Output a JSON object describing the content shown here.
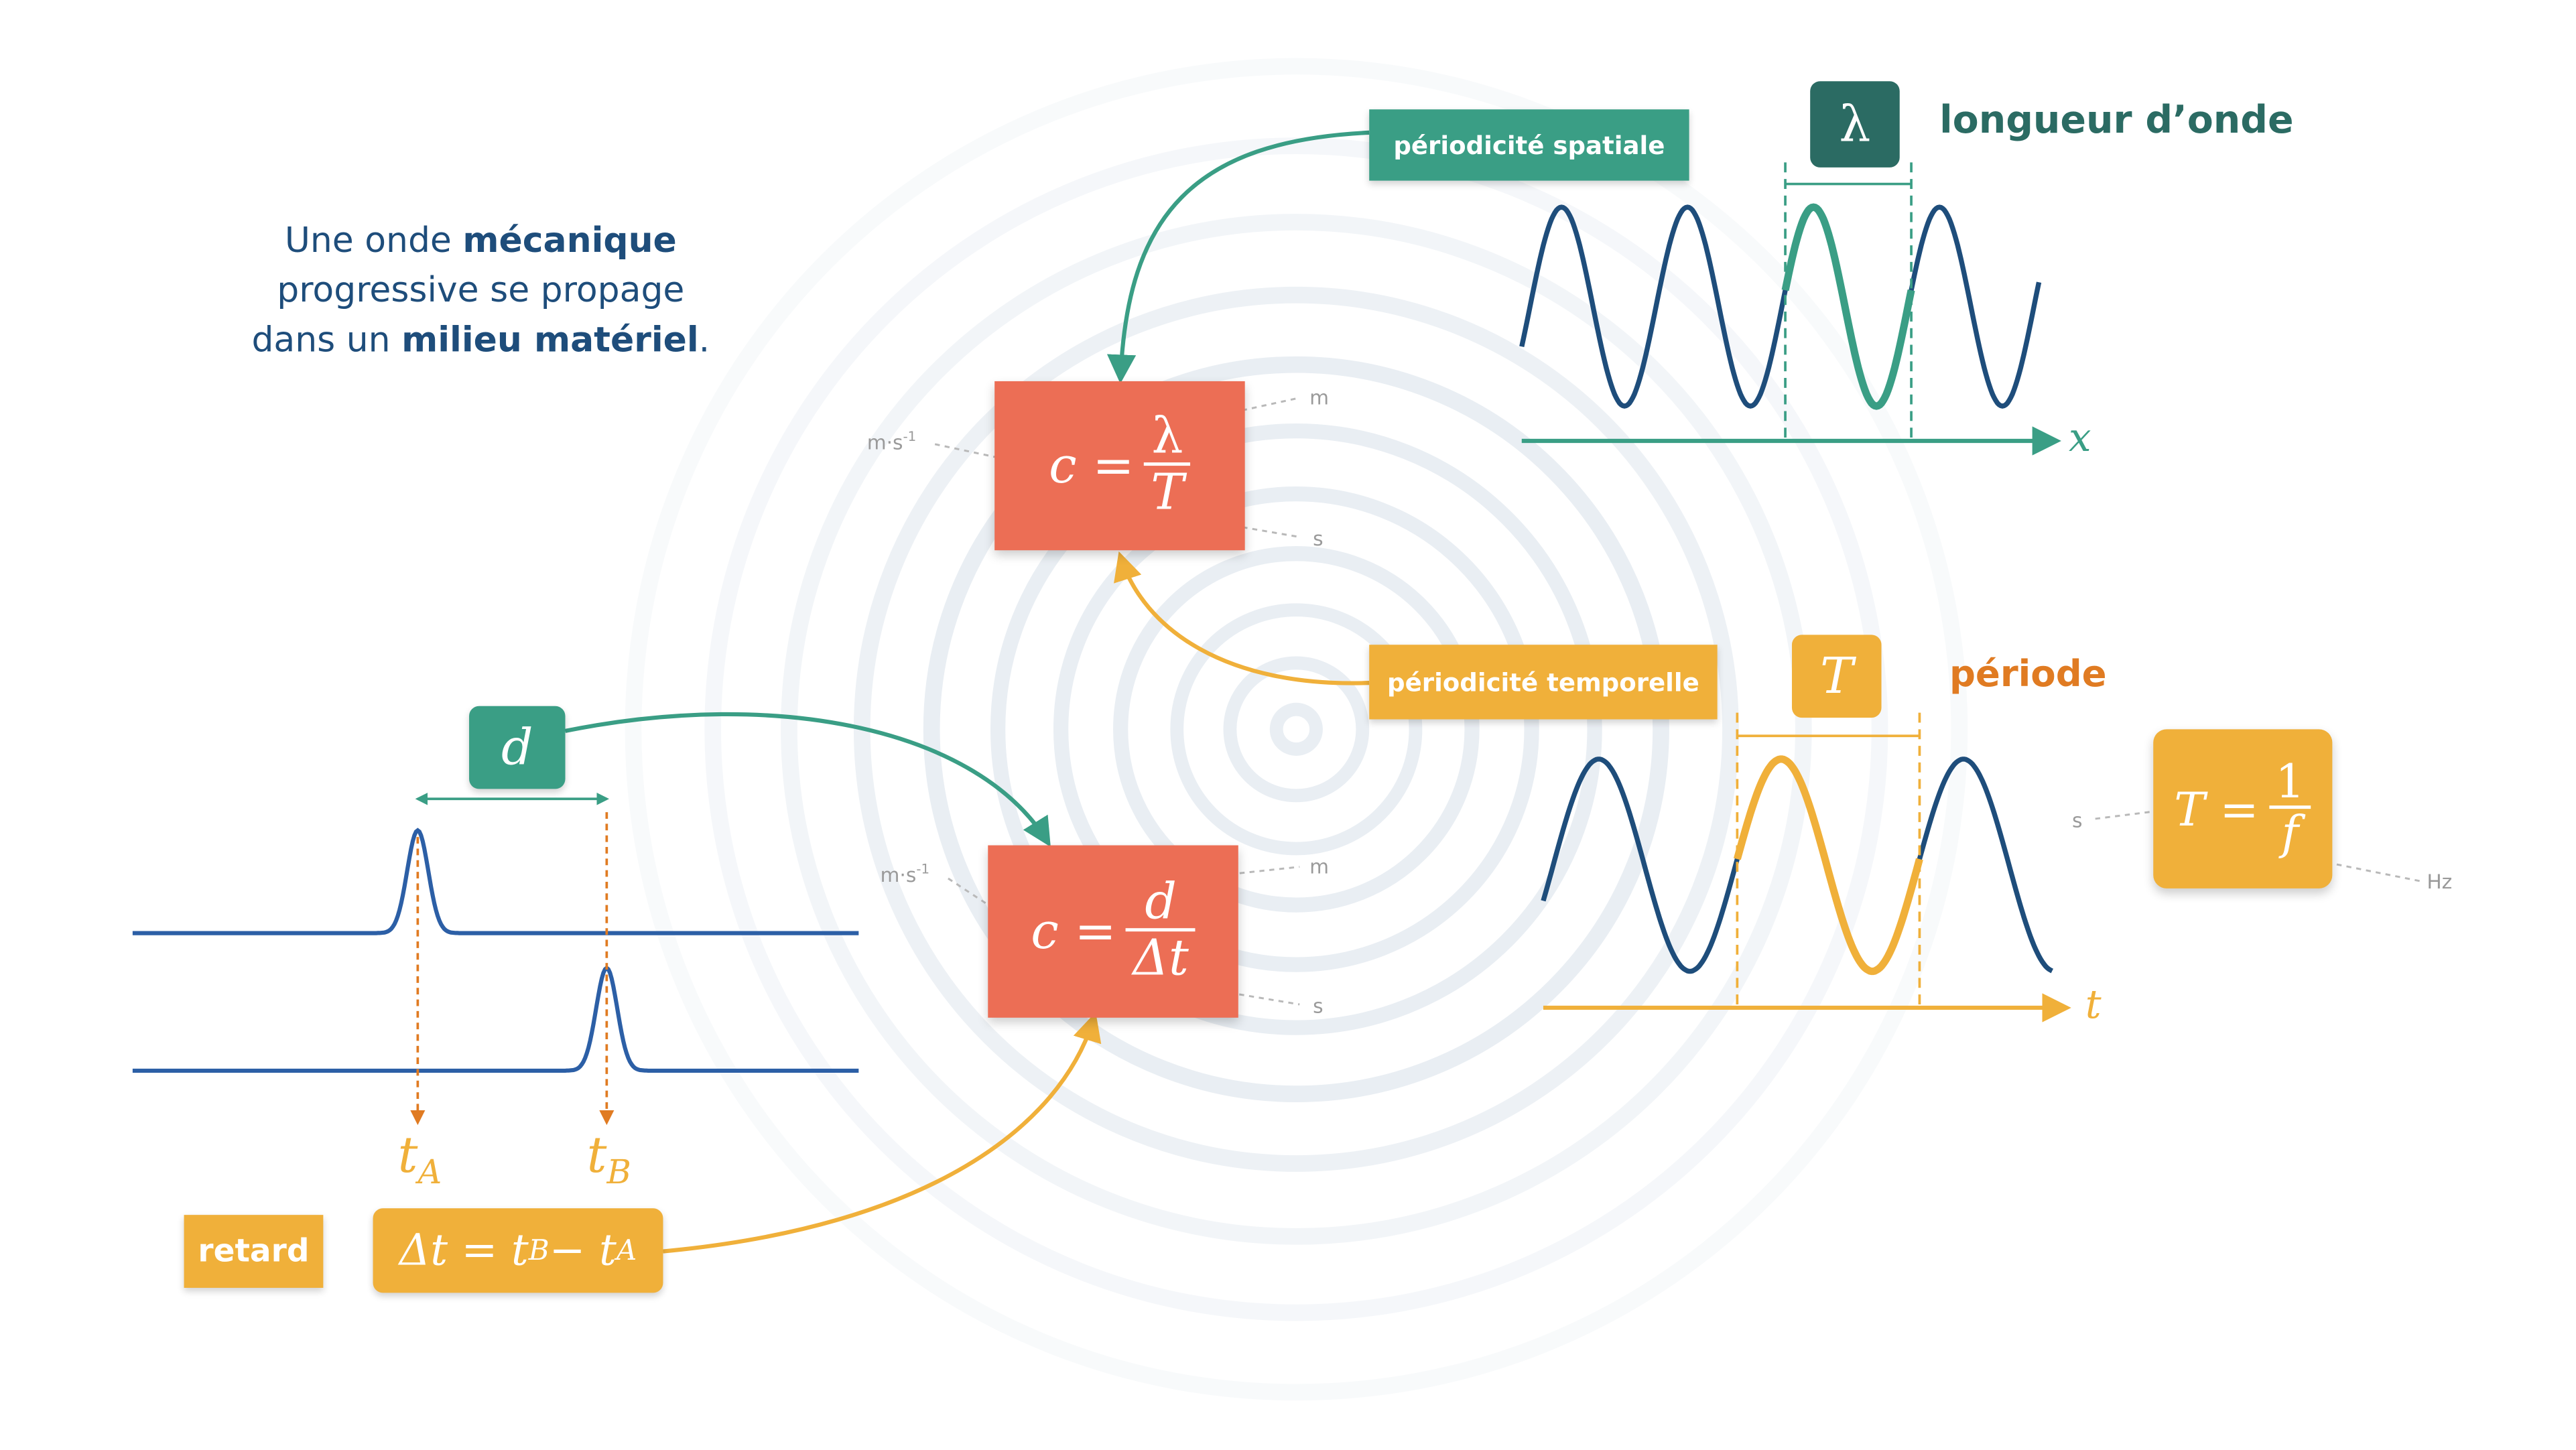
{
  "intro": {
    "line1_pre": "Une onde ",
    "line1_bold": "mécanique",
    "line2": "progressive se propage",
    "line3_pre": "dans un ",
    "line3_bold": "milieu matériel",
    "line3_post": "."
  },
  "spatial": {
    "tag": "périodicité spatiale",
    "symbol": "λ",
    "name": "longueur d’onde",
    "axis": "x"
  },
  "temporal": {
    "tag": "périodicité temporelle",
    "symbol": "T",
    "name": "période",
    "axis": "t"
  },
  "formula_lambda": {
    "lhs": "c =",
    "num": "λ",
    "den": "T",
    "unit_lhs": "m·s",
    "unit_lhs_exp": "-1",
    "unit_num": "m",
    "unit_den": "s"
  },
  "formula_d": {
    "lhs": "c =",
    "num": "d",
    "den": "Δt",
    "unit_lhs": "m·s",
    "unit_lhs_exp": "-1",
    "unit_num": "m",
    "unit_den": "s"
  },
  "formula_period": {
    "lhs": "T =",
    "num": "1",
    "den": "f",
    "unit_lhs": "s",
    "unit_den": "Hz"
  },
  "distance": {
    "symbol": "d"
  },
  "times": {
    "ta": "t",
    "ta_sub": "A",
    "tb": "t",
    "tb_sub": "B"
  },
  "delay": {
    "label": "retard",
    "delta": "Δt = t",
    "sub_b": "B",
    "minus": " − t",
    "sub_a": "A"
  },
  "colors": {
    "green": "#3a9e85",
    "dark_green": "#2b6b63",
    "orange": "#f0b03a",
    "red": "#ec6e55",
    "navy": "#1e4d7b",
    "dark_orange": "#e07b22",
    "pulse_blue": "#2c5fa6"
  }
}
